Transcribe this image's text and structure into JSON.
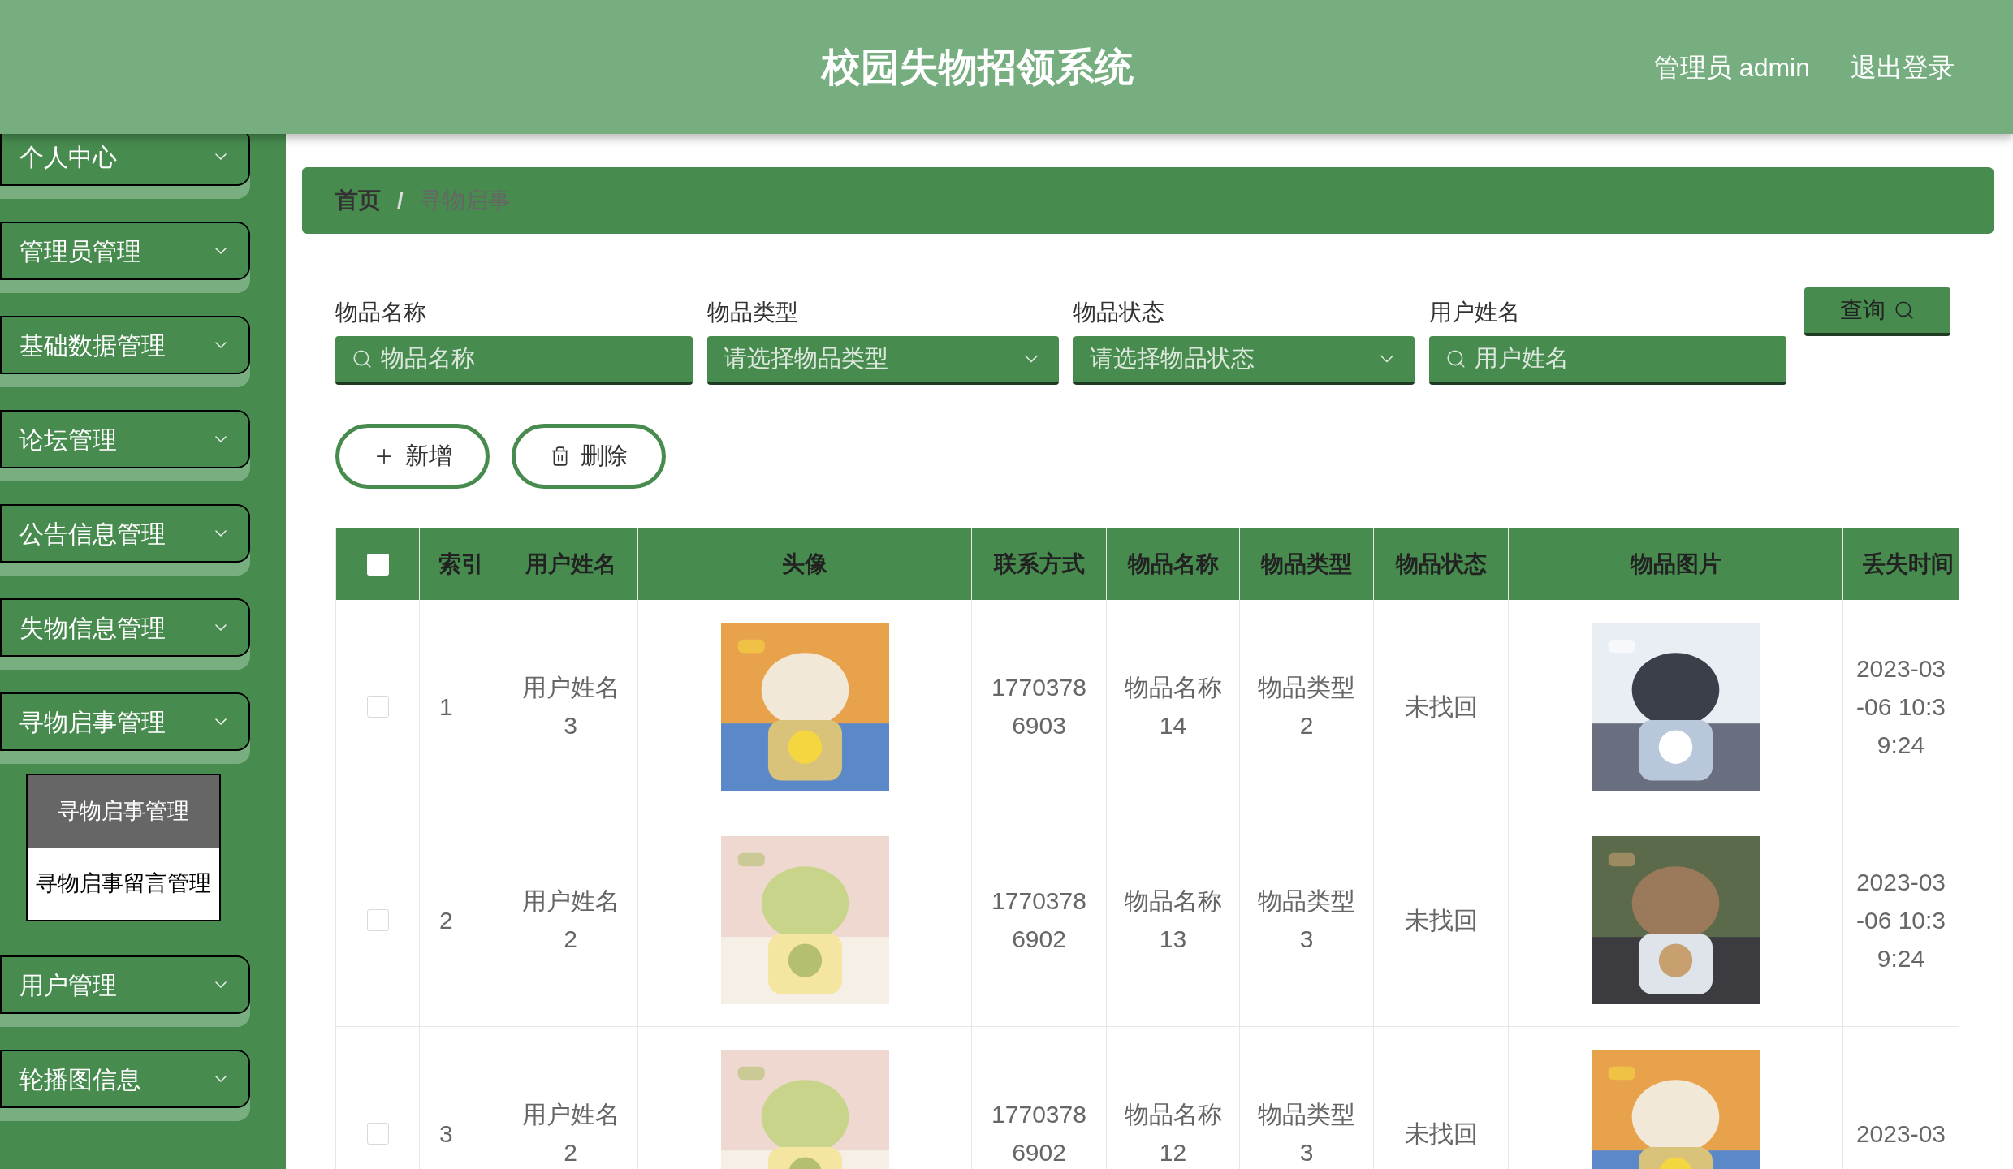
{
  "header": {
    "title": "校园失物招领系统",
    "user": "管理员 admin",
    "logout": "退出登录"
  },
  "sidebar": {
    "items": [
      {
        "label": "个人中心",
        "expanded": false
      },
      {
        "label": "管理员管理",
        "expanded": false
      },
      {
        "label": "基础数据管理",
        "expanded": false
      },
      {
        "label": "论坛管理",
        "expanded": false
      },
      {
        "label": "公告信息管理",
        "expanded": false
      },
      {
        "label": "失物信息管理",
        "expanded": false
      },
      {
        "label": "寻物启事管理",
        "expanded": true,
        "children": [
          {
            "label": "寻物启事管理",
            "selected": true
          },
          {
            "label": "寻物启事留言管理",
            "selected": false
          }
        ]
      },
      {
        "label": "用户管理",
        "expanded": false
      },
      {
        "label": "轮播图信息",
        "expanded": false
      }
    ]
  },
  "breadcrumb": [
    "首页",
    "/",
    "寻物启事"
  ],
  "search": {
    "fields": [
      {
        "label": "物品名称",
        "kind": "input",
        "placeholder": "物品名称"
      },
      {
        "label": "物品类型",
        "kind": "select",
        "placeholder": "请选择物品类型"
      },
      {
        "label": "物品状态",
        "kind": "select",
        "placeholder": "请选择物品状态"
      },
      {
        "label": "用户姓名",
        "kind": "input",
        "placeholder": "用户姓名"
      }
    ],
    "button": "查询"
  },
  "actions": [
    {
      "label": "新增",
      "kind": "add"
    },
    {
      "label": "删除",
      "kind": "delete"
    }
  ],
  "table": {
    "all_checked": false,
    "columns": [
      "索引",
      "用户姓名",
      "头像",
      "联系方式",
      "物品名称",
      "物品类型",
      "物品状态",
      "物品图片",
      "丢失时间"
    ],
    "rows": [
      {
        "checked": false,
        "cells": [
          "1",
          "用户姓名3",
          "",
          "17703786903",
          "物品名称14",
          "物品类型2",
          "未找回",
          "",
          "2023-03-06 10:39:24"
        ]
      },
      {
        "checked": false,
        "cells": [
          "2",
          "用户姓名2",
          "",
          "17703786902",
          "物品名称13",
          "物品类型3",
          "未找回",
          "",
          "2023-03-06 10:39:24"
        ]
      },
      {
        "checked": false,
        "cells": [
          "3",
          "用户姓名2",
          "",
          "17703786902",
          "物品名称12",
          "物品类型3",
          "未找回",
          "",
          "2023-03"
        ]
      }
    ]
  }
}
